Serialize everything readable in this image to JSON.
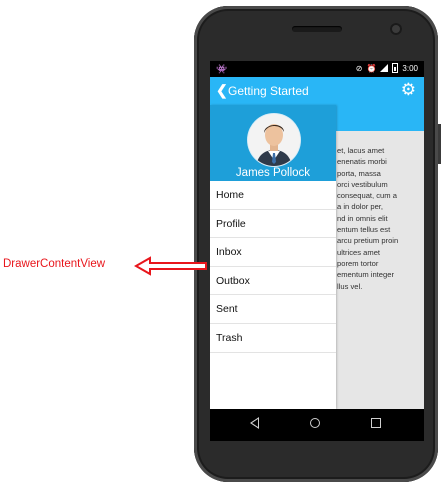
{
  "status_bar": {
    "time": "3:00"
  },
  "app_bar": {
    "title": "Getting Started"
  },
  "drawer": {
    "user_name": "James Pollock",
    "items": [
      {
        "label": "Home"
      },
      {
        "label": "Profile"
      },
      {
        "label": "Inbox"
      },
      {
        "label": "Outbox"
      },
      {
        "label": "Sent"
      },
      {
        "label": "Trash"
      }
    ]
  },
  "main_content": {
    "text": "et, lacus amet\nenenatis morbi\nporta, massa\norci vestibulum\nconsequat, cum a\na in dolor per,\nnd in omnis elit\nentum tellus est\narcu pretium proin\nultrices amet\nporem tortor\nementum integer\nllus vel."
  },
  "annotation": {
    "label": "DrawerContentView",
    "color": "#e8161c"
  },
  "colors": {
    "accent": "#29b6f6",
    "drawer_header": "#1e9fd9"
  }
}
